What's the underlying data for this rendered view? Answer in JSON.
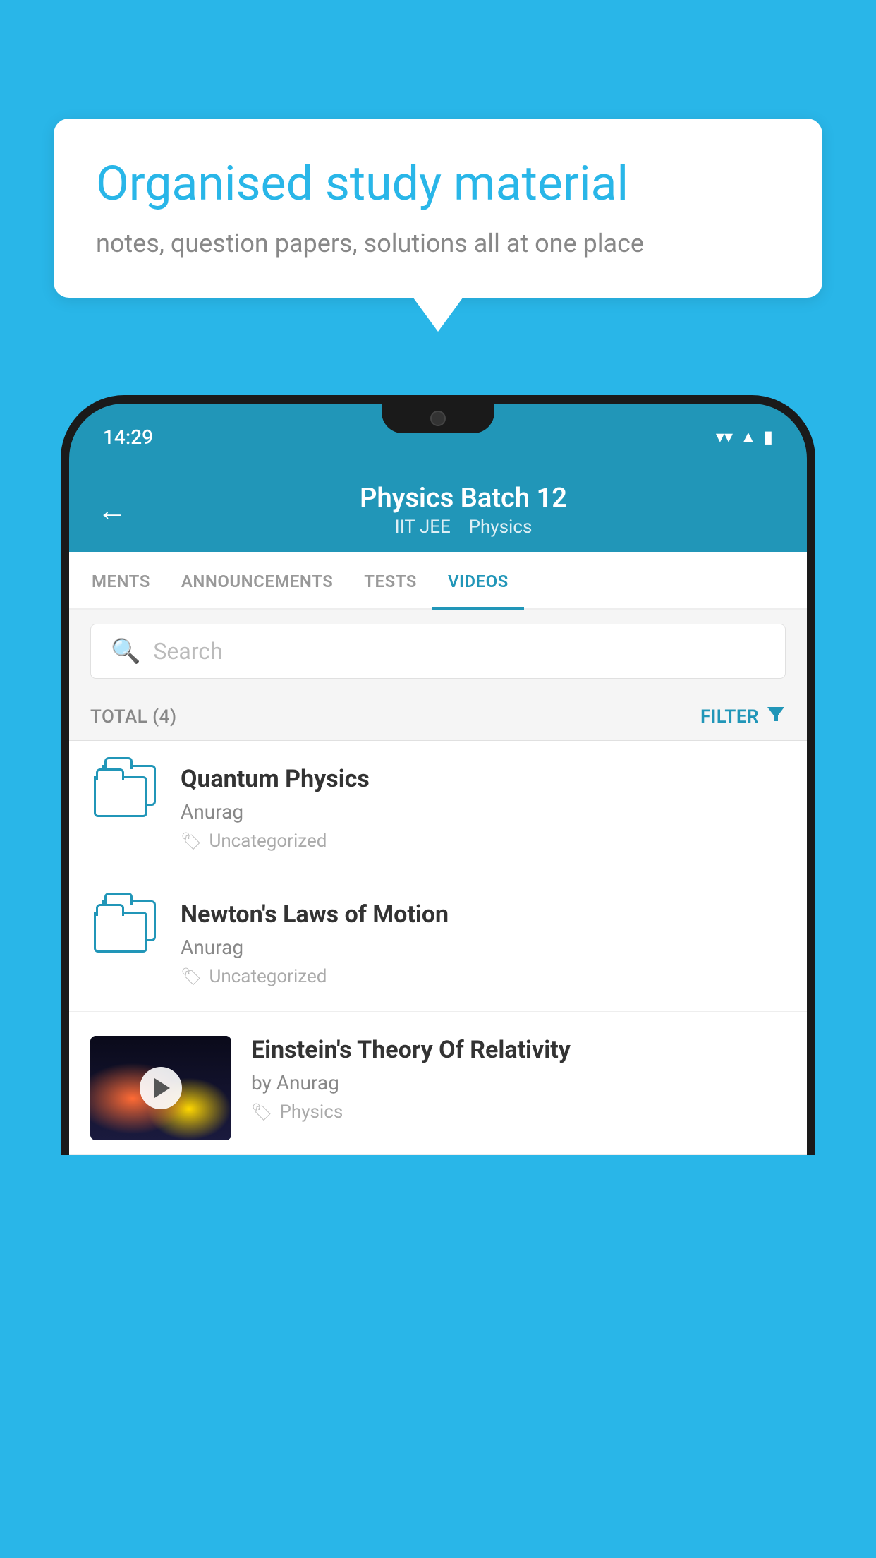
{
  "background": {
    "color": "#29b6e8"
  },
  "speech_bubble": {
    "heading": "Organised study material",
    "subtext": "notes, question papers, solutions all at one place"
  },
  "phone": {
    "status_bar": {
      "time": "14:29",
      "wifi_icon": "wifi",
      "signal_icon": "signal",
      "battery_icon": "battery"
    },
    "header": {
      "back_label": "←",
      "title": "Physics Batch 12",
      "subtitle_part1": "IIT JEE",
      "subtitle_part2": "Physics"
    },
    "tabs": [
      {
        "label": "MENTS",
        "active": false
      },
      {
        "label": "ANNOUNCEMENTS",
        "active": false
      },
      {
        "label": "TESTS",
        "active": false
      },
      {
        "label": "VIDEOS",
        "active": true
      }
    ],
    "search": {
      "placeholder": "Search"
    },
    "filter_row": {
      "total_label": "TOTAL (4)",
      "filter_label": "FILTER"
    },
    "videos": [
      {
        "title": "Quantum Physics",
        "author": "Anurag",
        "tag": "Uncategorized",
        "has_thumbnail": false
      },
      {
        "title": "Newton's Laws of Motion",
        "author": "Anurag",
        "tag": "Uncategorized",
        "has_thumbnail": false
      },
      {
        "title": "Einstein's Theory Of Relativity",
        "author": "by Anurag",
        "tag": "Physics",
        "has_thumbnail": true
      }
    ]
  }
}
